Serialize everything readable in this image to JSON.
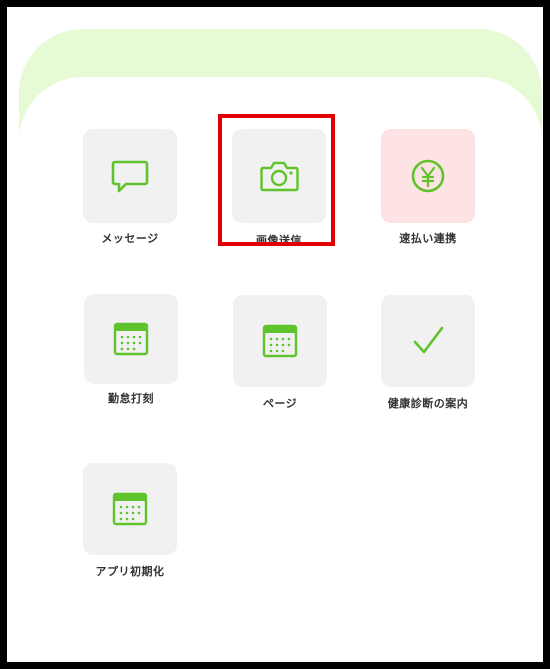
{
  "colors": {
    "accent": "#5fc42c",
    "highlight": "#e00000",
    "band": "#e6fad6"
  },
  "menu": {
    "items": [
      {
        "label": "メッセージ",
        "icon": "chat-bubble-icon"
      },
      {
        "label": "画像送信",
        "icon": "camera-icon",
        "highlighted": true
      },
      {
        "label": "速払い連携",
        "icon": "yen-coin-icon"
      },
      {
        "label": "勤怠打刻",
        "icon": "calendar-icon"
      },
      {
        "label": "ページ",
        "icon": "calendar-icon"
      },
      {
        "label": "健康診断の案内",
        "icon": "checkmark-icon"
      },
      {
        "label": "アプリ初期化",
        "icon": "calendar-icon"
      }
    ]
  }
}
